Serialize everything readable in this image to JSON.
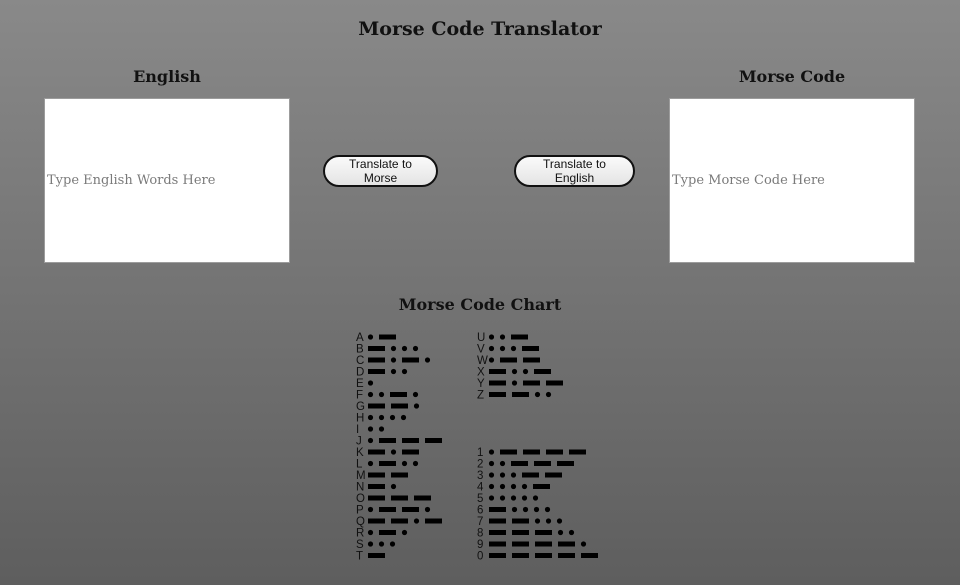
{
  "page": {
    "title": "Morse Code Translator"
  },
  "english": {
    "label": "English",
    "placeholder": "Type English Words Here",
    "value": ""
  },
  "morse": {
    "label": "Morse Code",
    "placeholder": "Type Morse Code Here",
    "value": ""
  },
  "buttons": {
    "to_morse": "Translate to Morse",
    "to_english": "Translate to English"
  },
  "chart": {
    "title": "Morse Code Chart",
    "columns": [
      [
        {
          "char": "A",
          "code": ".-"
        },
        {
          "char": "B",
          "code": "-..."
        },
        {
          "char": "C",
          "code": "-.-."
        },
        {
          "char": "D",
          "code": "-.."
        },
        {
          "char": "E",
          "code": "."
        },
        {
          "char": "F",
          "code": "..-."
        },
        {
          "char": "G",
          "code": "--."
        },
        {
          "char": "H",
          "code": "...."
        },
        {
          "char": "I",
          "code": ".."
        },
        {
          "char": "J",
          "code": ".---"
        },
        {
          "char": "K",
          "code": "-.-"
        },
        {
          "char": "L",
          "code": ".-.."
        },
        {
          "char": "M",
          "code": "--"
        },
        {
          "char": "N",
          "code": "-."
        },
        {
          "char": "O",
          "code": "---"
        },
        {
          "char": "P",
          "code": ".--."
        },
        {
          "char": "Q",
          "code": "--.-"
        },
        {
          "char": "R",
          "code": ".-."
        },
        {
          "char": "S",
          "code": "..."
        },
        {
          "char": "T",
          "code": "-"
        }
      ],
      [
        {
          "char": "U",
          "code": "..-"
        },
        {
          "char": "V",
          "code": "...-"
        },
        {
          "char": "W",
          "code": ".--"
        },
        {
          "char": "X",
          "code": "-..-"
        },
        {
          "char": "Y",
          "code": "-.--"
        },
        {
          "char": "Z",
          "code": "--.."
        },
        {
          "char": "",
          "code": ""
        },
        {
          "char": "",
          "code": ""
        },
        {
          "char": "",
          "code": ""
        },
        {
          "char": "",
          "code": ""
        },
        {
          "char": "1",
          "code": ".----"
        },
        {
          "char": "2",
          "code": "..---"
        },
        {
          "char": "3",
          "code": "...--"
        },
        {
          "char": "4",
          "code": "....-"
        },
        {
          "char": "5",
          "code": "....."
        },
        {
          "char": "6",
          "code": "-...."
        },
        {
          "char": "7",
          "code": "--..."
        },
        {
          "char": "8",
          "code": "---.."
        },
        {
          "char": "9",
          "code": "----."
        },
        {
          "char": "0",
          "code": "-----"
        }
      ]
    ]
  }
}
